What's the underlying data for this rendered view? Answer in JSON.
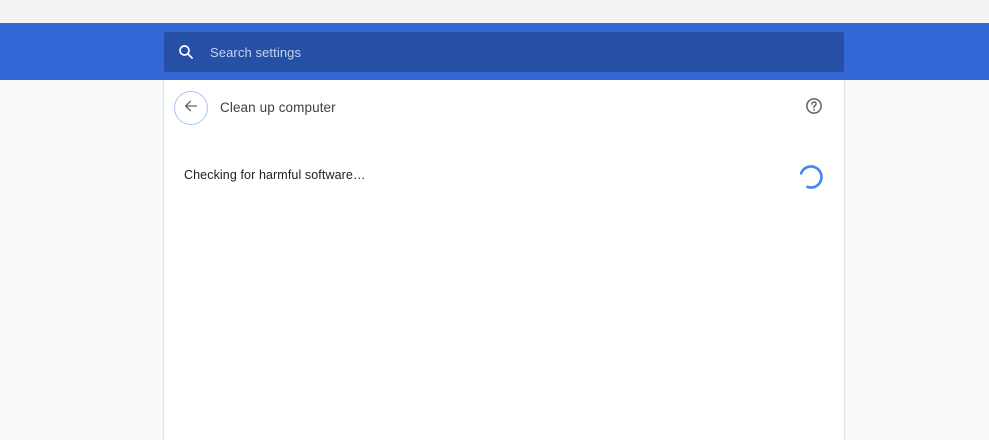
{
  "search": {
    "placeholder": "Search settings",
    "icon": "search-icon"
  },
  "header": {
    "title": "Clean up computer",
    "back_icon": "arrow-back-icon",
    "help_icon": "help-circle-icon"
  },
  "status": {
    "text": "Checking for harmful software…",
    "spinner_icon": "loading-spinner-icon"
  },
  "colors": {
    "header_blue": "#3367d6",
    "search_bg": "#264fa6",
    "spinner": "#4285f4",
    "back_border": "#a8c4f2"
  }
}
